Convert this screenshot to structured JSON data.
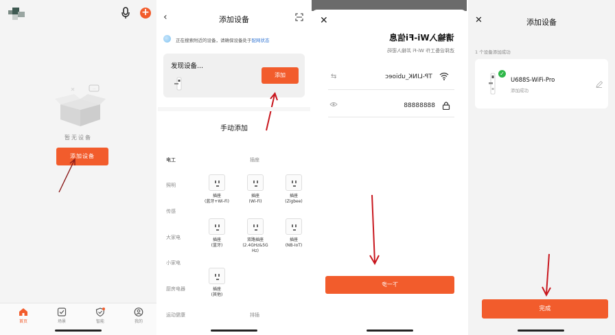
{
  "panel_home": {
    "empty_text": "暂无设备",
    "add_device_label": "添加设备",
    "tabs": [
      {
        "label": "首页",
        "icon": "home-icon"
      },
      {
        "label": "场景",
        "icon": "checkbox-icon"
      },
      {
        "label": "智能",
        "icon": "shield-icon"
      },
      {
        "label": "我的",
        "icon": "profile-icon"
      }
    ]
  },
  "panel_add": {
    "title": "添加设备",
    "search_hint": "正在搜索附近的设备，请确保设备处于",
    "search_hint_link": "配网状态",
    "found_title": "发现设备...",
    "found_add_label": "添加",
    "manual_title": "手动添加",
    "categories": [
      "电工",
      "照明",
      "传感",
      "大家电",
      "小家电",
      "厨房电器",
      "运动健康"
    ],
    "sub_header_top": "插座",
    "sub_header_bottom": "排插",
    "devices": [
      {
        "label": "插座\n(蓝牙+Wi-Fi)"
      },
      {
        "label": "插座\n(Wi-Fi)"
      },
      {
        "label": "插座\n(Zigbee)"
      },
      {
        "label": "插座\n(蓝牙)"
      },
      {
        "label": "双路插座\n(2.4GHz&5G\nHz)"
      },
      {
        "label": "插座\n(NB-IoT)"
      },
      {
        "label": "插座\n(其他)"
      }
    ]
  },
  "panel_wifi": {
    "title": "请输入Wi-Fi信息",
    "subtitle": "选择设备工作 Wi-Fi 并输入密码",
    "ssid": "TP-LINK_ubioec",
    "password": "88888888",
    "next_label": "下一步"
  },
  "panel_done": {
    "title": "添加设备",
    "count_text": "1 个设备添加成功",
    "device_name": "U688S-WiFi-Pro",
    "device_status": "添加成功",
    "done_label": "完成"
  },
  "colors": {
    "accent": "#f25c2c",
    "arrow": "#c8161d",
    "success": "#2fb84a",
    "link": "#3a7bd5"
  }
}
